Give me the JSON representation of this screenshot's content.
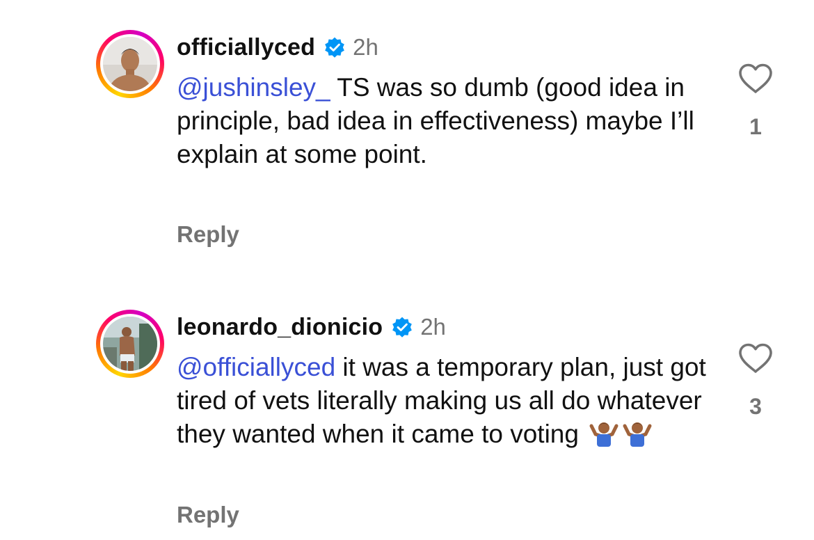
{
  "comments": [
    {
      "username": "officiallyced",
      "time": "2h",
      "mention": "@jushinsley_",
      "text": " TS was so dumb (good idea in principle, bad idea in effectiveness) maybe I’ll explain at some point.",
      "reply_label": "Reply",
      "likes": "1",
      "avatar_icon": "avatar-photo",
      "verified_icon": "verified-badge-icon"
    },
    {
      "username": "leonardo_dionicio",
      "time": "2h",
      "mention": "@officiallyced",
      "text": " it was a temporary plan, just got tired of vets literally making us all do whatever they wanted when it came to voting ",
      "emoji": [
        "man-shrugging-emoji",
        "man-shrugging-emoji"
      ],
      "reply_label": "Reply",
      "likes": "3",
      "avatar_icon": "avatar-photo",
      "verified_icon": "verified-badge-icon"
    }
  ],
  "colors": {
    "mention": "#3a50d6",
    "verified": "#0095f6",
    "secondary_text": "#737373",
    "story_ring_start": "#ffd600",
    "story_ring_end": "#d300c5"
  }
}
